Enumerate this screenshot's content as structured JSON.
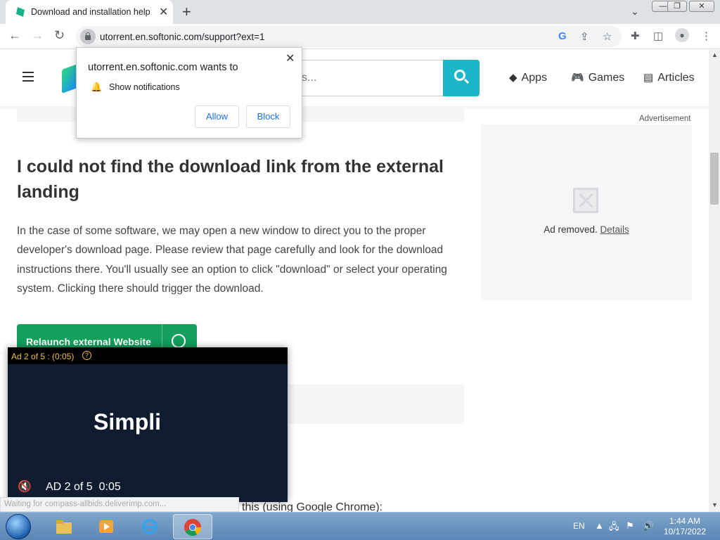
{
  "browser": {
    "tab_title": "Download and installation help",
    "url": "utorrent.en.softonic.com/support?ext=1",
    "status_text": "Waiting for compass-allbids.deliverimp.com..."
  },
  "site_header": {
    "search_placeholder": "s...",
    "nav": [
      {
        "label": "Apps",
        "icon": "apps-icon"
      },
      {
        "label": "Games",
        "icon": "gamepad-icon"
      },
      {
        "label": "Articles",
        "icon": "articles-icon"
      }
    ]
  },
  "article": {
    "heading": "I could not find the download link from the external landing",
    "paragraph": "In the case of some software, we may open a new window to direct you to the proper developer's download page. Please review that page carefully and look for the download instructions there. You'll usually see an option to click \"download\" or select your operating system. Clicking there should trigger the download.",
    "relaunch_label": "Relaunch external Website",
    "bottom_text": "this (using Google Chrome):"
  },
  "sidebar_ad": {
    "label": "Advertisement",
    "removed_text": "Ad removed.",
    "details_link": "Details"
  },
  "video_ad": {
    "counter": "Ad 2 of 5 : (0:05)",
    "help": "?",
    "brand": "Simpli",
    "bottom_label": "AD 2 of 5",
    "time": "0:05"
  },
  "notification_prompt": {
    "message": "utorrent.en.softonic.com wants to",
    "permission": "Show notifications",
    "allow": "Allow",
    "block": "Block"
  },
  "taskbar": {
    "language": "EN",
    "time": "1:44 AM",
    "date": "10/17/2022"
  },
  "colors": {
    "accent_green": "#12a05c",
    "search_teal": "#1bb7c9",
    "ad_yellow": "#f0c040"
  }
}
